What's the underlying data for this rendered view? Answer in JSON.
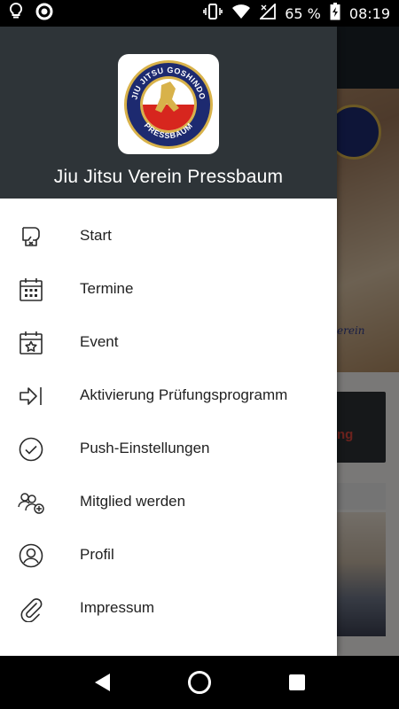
{
  "status_bar": {
    "battery_percent": "65 %",
    "time": "08:19",
    "icons": [
      "lightbulb-icon",
      "circle-app-icon",
      "vibrate-icon",
      "wifi-icon",
      "signal-icon",
      "battery-charging-icon"
    ]
  },
  "drawer": {
    "title": "Jiu Jitsu Verein Pressbaum",
    "logo": {
      "top_text": "JIU JITSU GOSHINDO",
      "bottom_text": "PRESSBAUM",
      "colors": {
        "ring": "#1d2a70",
        "gold": "#d8b24a",
        "red": "#d7261e",
        "white": "#ffffff"
      }
    },
    "items": [
      {
        "label": "Start",
        "icon": "boxing-glove-icon"
      },
      {
        "label": "Termine",
        "icon": "calendar-icon"
      },
      {
        "label": "Event",
        "icon": "calendar-star-icon"
      },
      {
        "label": "Aktivierung Prüfungsprogramm",
        "icon": "arrow-into-bar-icon"
      },
      {
        "label": "Push-Einstellungen",
        "icon": "check-circle-icon"
      },
      {
        "label": "Mitglied werden",
        "icon": "add-member-icon"
      },
      {
        "label": "Profil",
        "icon": "user-circle-icon"
      },
      {
        "label": "Impressum",
        "icon": "paperclip-icon"
      }
    ]
  },
  "background": {
    "card_text": "ng",
    "script_text": "erein"
  },
  "nav_bar": {
    "icons": [
      "back-icon",
      "home-icon",
      "recents-icon"
    ]
  },
  "colors": {
    "drawer_header_bg": "#2e3438",
    "icon_color": "#2b2b2b",
    "text_color": "#212121"
  }
}
